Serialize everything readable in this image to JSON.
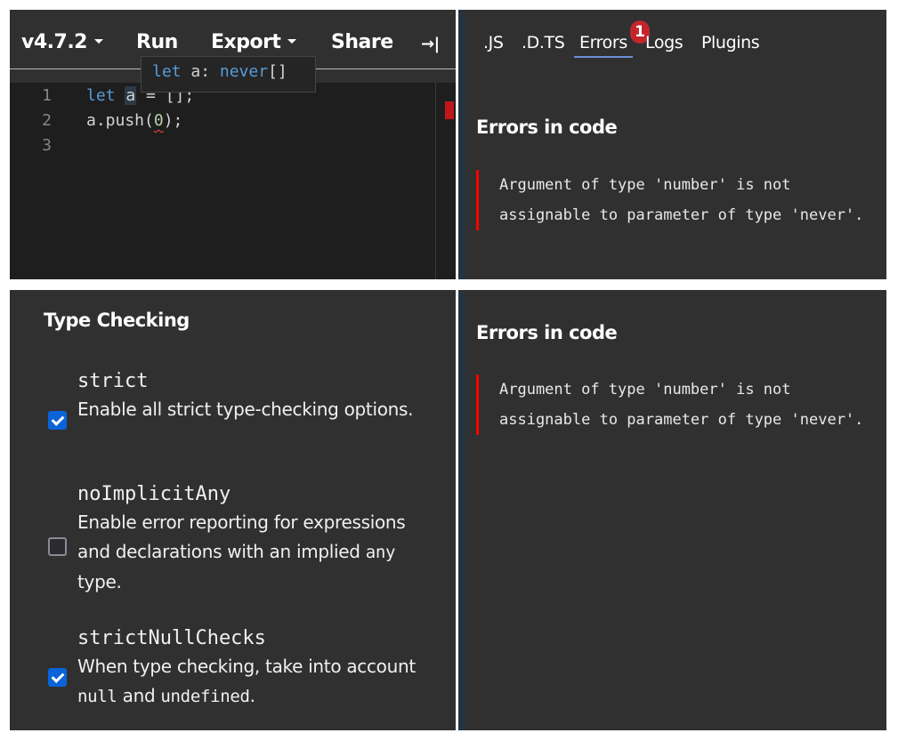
{
  "toolbar": {
    "version": "v4.7.2",
    "run": "Run",
    "export": "Export",
    "share": "Share",
    "collapse_icon": "→|"
  },
  "hover_tooltip": {
    "keyword": "let",
    "name": " a: ",
    "type": "never",
    "suffix": "[]"
  },
  "editor": {
    "line_numbers": [
      "1",
      "2",
      "3"
    ],
    "lines": [
      {
        "kw": "let",
        "var": "a",
        "rest": " = [];"
      },
      {
        "before": "a.push(",
        "arg": "0",
        "after": ");"
      },
      {
        "text": ""
      }
    ]
  },
  "sidebar_tabs": {
    "items": [
      ".JS",
      ".D.TS",
      "Errors",
      "Logs",
      "Plugins"
    ],
    "active": "Errors",
    "errors_badge": "1"
  },
  "errors_top": {
    "title": "Errors in code",
    "messages": [
      "Argument of type 'number' is not assignable to parameter of type 'never'."
    ]
  },
  "errors_bottom": {
    "title": "Errors in code",
    "messages": [
      "Argument of type 'number' is not assignable to parameter of type 'never'."
    ]
  },
  "settings": {
    "title": "Type Checking",
    "options": [
      {
        "name": "strict",
        "desc": "Enable all strict type-checking options.",
        "checked": true
      },
      {
        "name": "noImplicitAny",
        "desc_pre": "Enable error reporting for expressions and declarations with an implied ",
        "desc_code": "any",
        "desc_post": " type.",
        "checked": false
      },
      {
        "name": "strictNullChecks",
        "desc_pre": "When type checking, take into account ",
        "desc_code1": "null",
        "desc_mid": " and ",
        "desc_code2": "undefined",
        "desc_post": ".",
        "checked": true
      }
    ]
  },
  "colors": {
    "panel_bg": "#303030",
    "editor_bg": "#1e1e1e",
    "keyword": "#569cd6",
    "number": "#b5cea8",
    "error_red": "#ff0000",
    "badge_red": "#c2262b",
    "checkbox_blue": "#0b63d8",
    "tab_underline": "#6a8ed8"
  }
}
